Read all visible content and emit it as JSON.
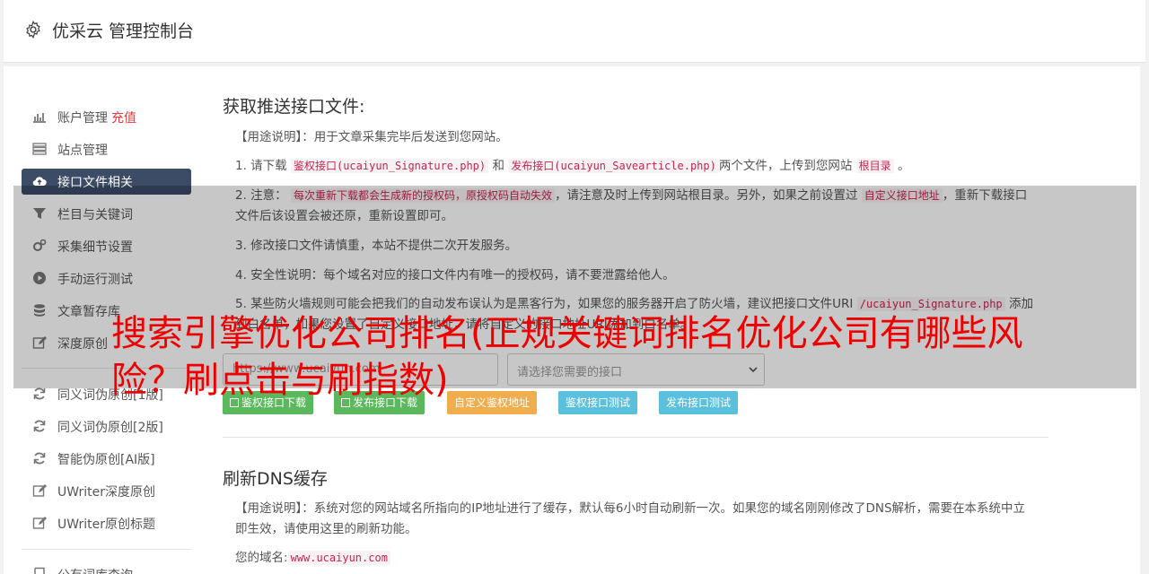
{
  "header": {
    "title": "优采云 管理控制台"
  },
  "sidebar": {
    "items": [
      {
        "label": "账户管理",
        "extra": "充值",
        "icon": "bar-chart-icon"
      },
      {
        "label": "站点管理",
        "icon": "list-icon"
      },
      {
        "label": "接口文件相关",
        "icon": "cloud-upload-icon",
        "active": true
      },
      {
        "label": "栏目与关键词",
        "icon": "filter-icon"
      },
      {
        "label": "采集细节设置",
        "icon": "gears-icon"
      },
      {
        "label": "手动运行测试",
        "icon": "play-icon"
      },
      {
        "label": "文章暂存库",
        "icon": "database-icon"
      },
      {
        "label": "深度原创",
        "icon": "edit-icon"
      },
      {
        "label": "同义词伪原创[1版]",
        "icon": "refresh-icon"
      },
      {
        "label": "同义词伪原创[2版]",
        "icon": "refresh-icon"
      },
      {
        "label": "智能伪原创[AI版]",
        "icon": "refresh-icon"
      },
      {
        "label": "UWriter深度原创",
        "icon": "edit-icon"
      },
      {
        "label": "UWriter原创标题",
        "icon": "edit-icon"
      },
      {
        "label": "公有词库查询",
        "icon": "book-icon"
      }
    ]
  },
  "interface": {
    "title": "获取推送接口文件:",
    "usage_label": "【用途说明】",
    "usage_text": "：用于文章采集完毕后发送到您网站。",
    "p1_a": "1. 请下载",
    "p1_code1": "鉴权接口(ucaiyun_Signature.php)",
    "p1_b": "和",
    "p1_code2": "发布接口(ucaiyun_Savearticle.php)",
    "p1_c": "两个文件，上传到您网站",
    "p1_code3": "根目录",
    "p1_d": "。",
    "p2_a": "2. 注意：",
    "p2_code1": "每次重新下载都会生成新的授权码，原授权码自动失效",
    "p2_b": "，请注意及时上传到网站根目录。另外，如果之前设置过",
    "p2_code2": "自定义接口地址",
    "p2_c": "，重新下载接口文件后该设置会被还原，重新设置即可。",
    "p3": "3. 修改接口文件请慎重，本站不提供二次开发服务。",
    "p4": "4. 安全性说明：每个域名对应的接口文件内有唯一的授权码，请不要泄露给他人。",
    "p5_a": "5. 某些防火墙规则可能会把我们的自动发布误认为是黑客行为，如果您的服务器开启了防火墙，建议把接口文件URI",
    "p5_code": "/ucaiyun_Signature.php",
    "p5_b": "添加到白名单，如果您设置了自定义接口地址，请将自定义的接口地址URI添加到白名单。",
    "url_placeholder": "https://www.ucaiyun.com",
    "select_placeholder": "请选择您需要的接口",
    "buttons": {
      "download_sign": "鉴权接口下载",
      "download_publish": "发布接口下载",
      "custom_address": "自定义鉴权地址",
      "test_sign": "鉴权接口测试",
      "test_publish": "发布接口测试"
    }
  },
  "dns": {
    "title": "刷新DNS缓存",
    "usage_label": "【用途说明】",
    "usage_text": "：系统对您的网站域名所指向的IP地址进行了缓存，默认每6小时自动刷新一次。如果您的域名刚刚修改了DNS解析，需要在本系统中立即生效，请使用这里的刷新功能。",
    "domain_label": "您的域名:",
    "domain_value": "www.ucaiyun.com"
  },
  "overlay_headline": "搜索引擎优化公司排名(正规关键词排名优化公司有哪些风险？刷点击与刷指数)",
  "colors": {
    "active_nav": "#3c4b66",
    "accent_red": "#e4393c",
    "headline_red": "#ee0000"
  }
}
